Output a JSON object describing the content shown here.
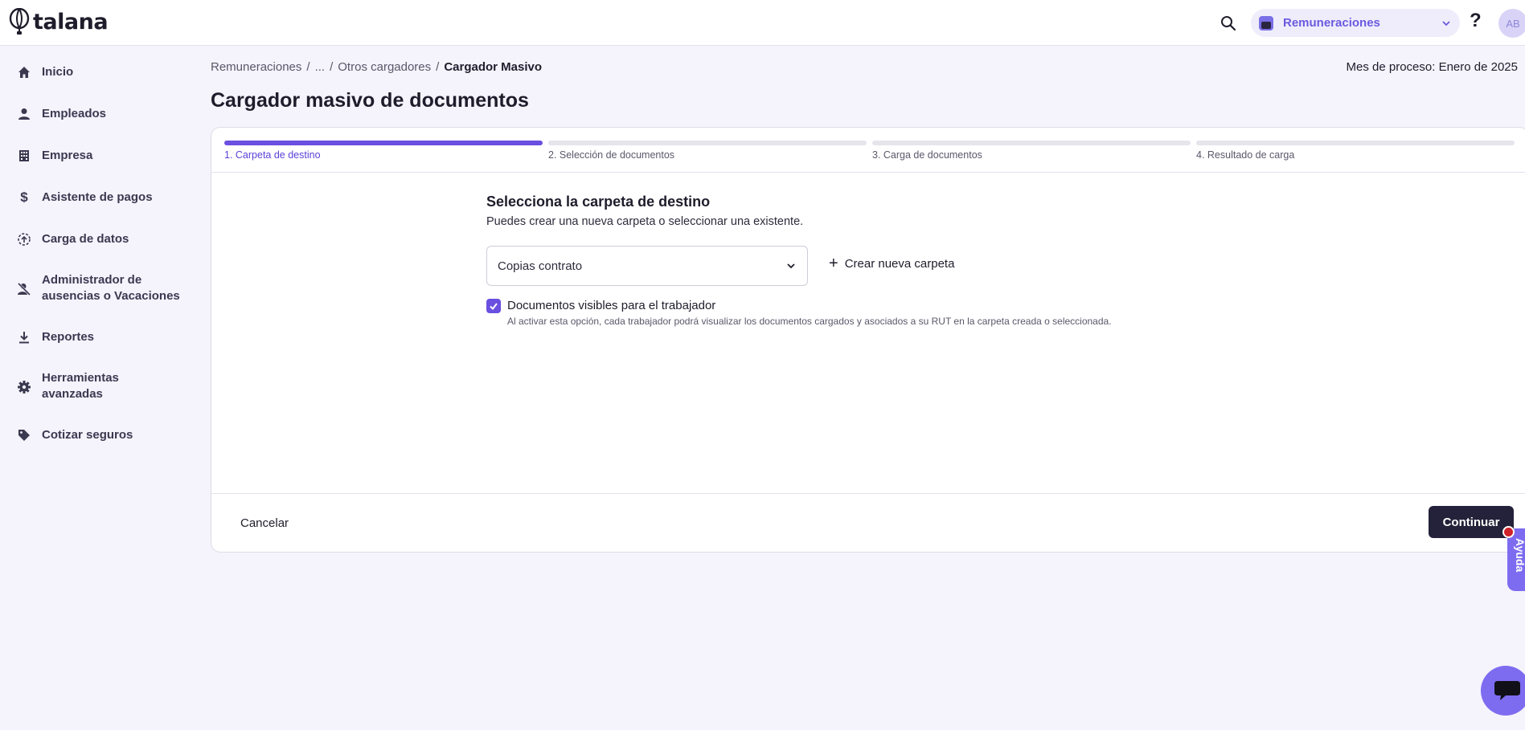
{
  "header": {
    "logo_text": "talana",
    "module_label": "Remuneraciones",
    "help_label": "?",
    "avatar_initials": "AB"
  },
  "sidebar": {
    "items": [
      {
        "label": "Inicio",
        "icon": "home-icon"
      },
      {
        "label": "Empleados",
        "icon": "person-icon"
      },
      {
        "label": "Empresa",
        "icon": "building-icon"
      },
      {
        "label": "Asistente de pagos",
        "icon": "dollar-icon"
      },
      {
        "label": "Carga de datos",
        "icon": "upload-icon"
      },
      {
        "label": "Administrador de ausencias o Vacaciones",
        "icon": "person-off-icon"
      },
      {
        "label": "Reportes",
        "icon": "download-icon"
      },
      {
        "label": "Herramientas avanzadas",
        "icon": "gear-icon"
      },
      {
        "label": "Cotizar seguros",
        "icon": "tag-icon"
      }
    ]
  },
  "breadcrumb": {
    "items": [
      "Remuneraciones",
      "...",
      "Otros cargadores"
    ],
    "separator": "/",
    "current": "Cargador Masivo"
  },
  "process_month": "Mes de proceso: Enero de 2025",
  "page_title": "Cargador masivo de documentos",
  "stepper": {
    "steps": [
      {
        "label": "1. Carpeta de destino",
        "active": true
      },
      {
        "label": "2. Selección de documentos",
        "active": false
      },
      {
        "label": "3. Carga de documentos",
        "active": false
      },
      {
        "label": "4. Resultado de carga",
        "active": false
      }
    ]
  },
  "form": {
    "title": "Selecciona la carpeta de destino",
    "subtitle": "Puedes crear una nueva carpeta o seleccionar una existente.",
    "folder_value": "Copias contrato",
    "new_folder_label": "Crear nueva carpeta",
    "visible_checkbox": {
      "checked": true,
      "label": "Documentos visibles para el trabajador",
      "help": "Al activar esta opción, cada trabajador podrá visualizar los documentos cargados y asociados a su RUT en la carpeta creada o seleccionada."
    }
  },
  "footer": {
    "cancel_label": "Cancelar",
    "continue_label": "Continuar"
  },
  "widgets": {
    "help_tab_label": "Ayuda"
  },
  "colors": {
    "accent": "#6a4fe0",
    "background": "#f5f3fc",
    "primary_button": "#24223a",
    "notification": "#d0202a"
  }
}
